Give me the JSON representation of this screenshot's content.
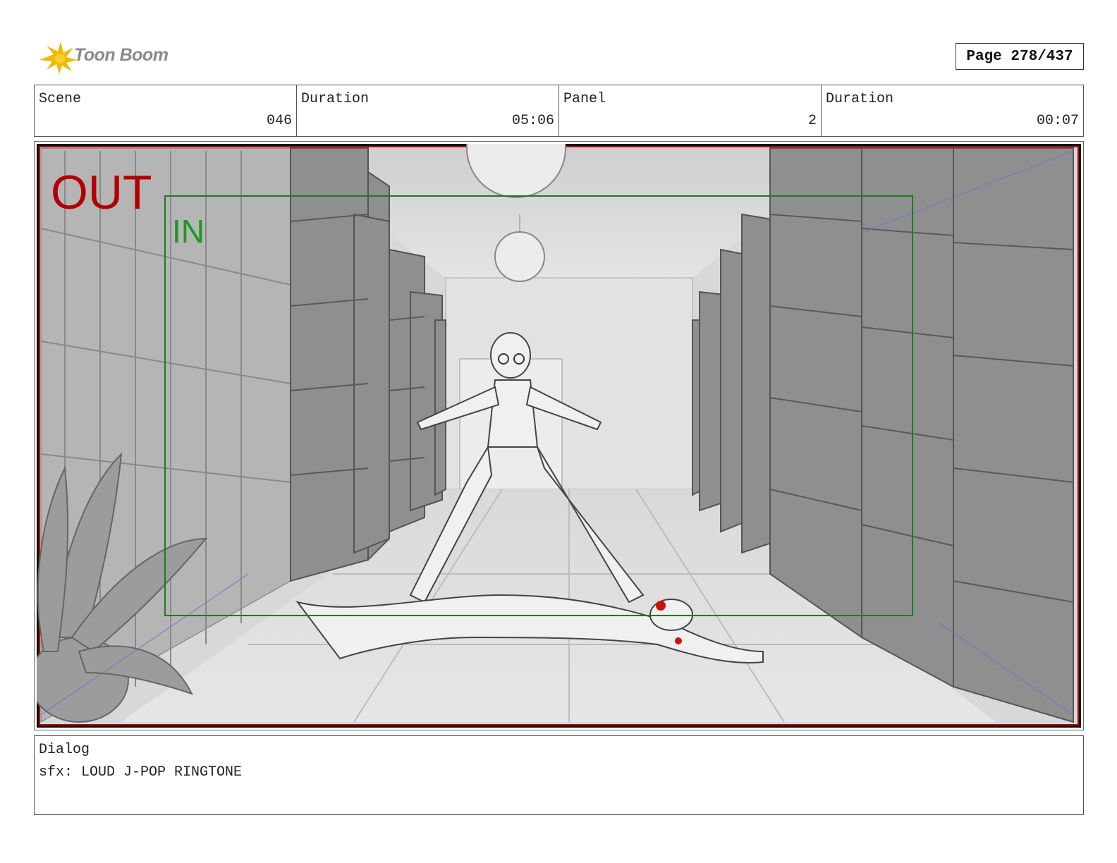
{
  "header": {
    "logo_text": "Toon Boom",
    "page_label": "Page 278/437"
  },
  "info": {
    "scene_label": "Scene",
    "scene_value": "046",
    "scene_duration_label": "Duration",
    "scene_duration_value": "05:06",
    "panel_label": "Panel",
    "panel_value": "2",
    "panel_duration_label": "Duration",
    "panel_duration_value": "00:07"
  },
  "frame": {
    "out_label": "OUT",
    "in_label": "IN",
    "out_color": "#b30000",
    "in_color": "#1a9a1a"
  },
  "dialog": {
    "label": "Dialog",
    "text": "sfx: LOUD J-POP RINGTONE"
  }
}
